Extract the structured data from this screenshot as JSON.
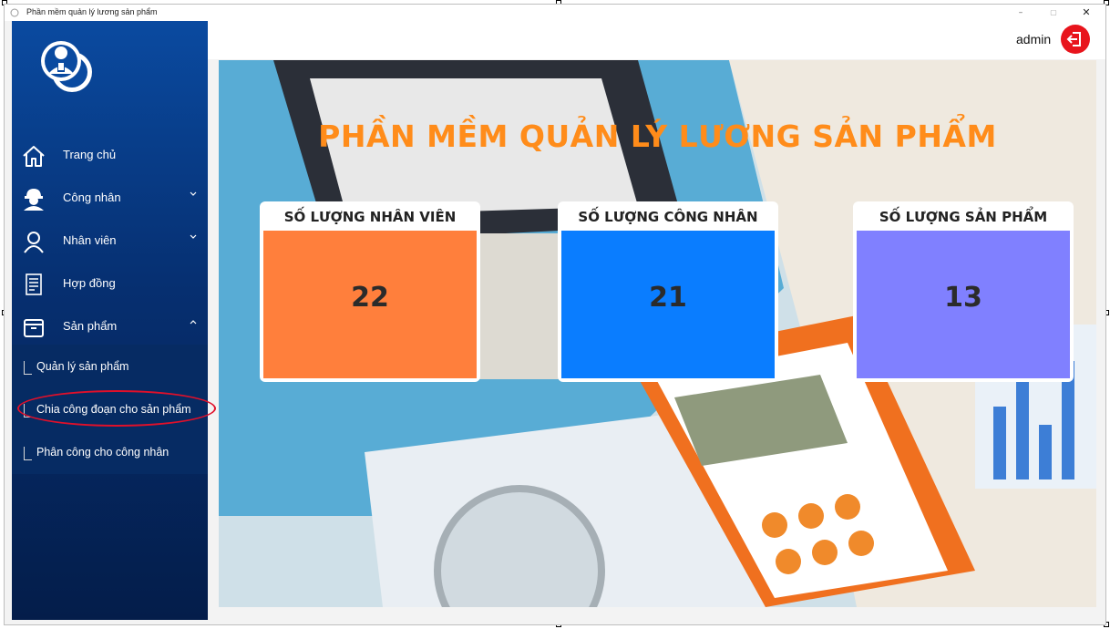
{
  "window": {
    "title": "Phần mềm quản lý lương sản phẩm",
    "minimize": "–",
    "restore": "▢",
    "close": "✕"
  },
  "header": {
    "username": "admin",
    "logout_icon": "logout-icon"
  },
  "sidebar": {
    "items": [
      {
        "label": "Trang chủ",
        "icon": "home-icon"
      },
      {
        "label": "Công nhân",
        "icon": "worker-helmet-icon",
        "expand": "chevron-down-icon"
      },
      {
        "label": "Nhân viên",
        "icon": "user-icon",
        "expand": "chevron-down-icon"
      },
      {
        "label": "Hợp đồng",
        "icon": "document-icon"
      },
      {
        "label": "Sản phẩm",
        "icon": "box-icon",
        "expand": "chevron-up-icon"
      }
    ],
    "subitems": [
      {
        "label": "Quản lý sản phẩm"
      },
      {
        "label": "Chia công đoạn cho sản phẩm"
      },
      {
        "label": "Phân công cho công nhân"
      }
    ]
  },
  "main": {
    "title": "PHẦN MỀM QUẢN LÝ LƯƠNG SẢN PHẨM",
    "cards": [
      {
        "label": "SỐ LƯỢNG NHÂN VIÊN",
        "value": "22",
        "color": "#ff7f3c"
      },
      {
        "label": "SỐ LƯỢNG CÔNG NHÂN",
        "value": "21",
        "color": "#0a7dff"
      },
      {
        "label": "SỐ LƯỢNG SẢN PHẨM",
        "value": "13",
        "color": "#8080ff"
      }
    ]
  },
  "colors": {
    "sidebar": "#062f70",
    "accent_title": "#ff8c1a",
    "logout": "#e8141c",
    "highlight": "#e0102a"
  }
}
